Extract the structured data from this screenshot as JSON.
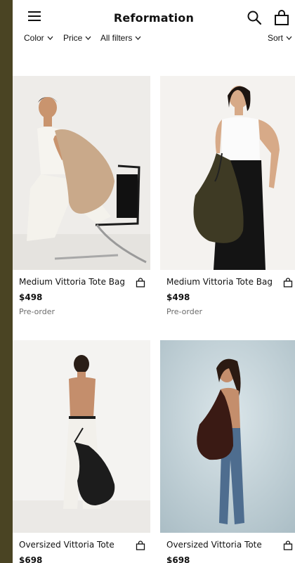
{
  "header": {
    "brand": "Reformation",
    "menu_icon": "hamburger-menu-icon",
    "search_icon": "search-icon",
    "cart_icon": "shopping-bag-icon"
  },
  "filters": {
    "color": "Color",
    "price": "Price",
    "all": "All filters",
    "sort": "Sort"
  },
  "products": [
    {
      "name": "Medium Vittoria Tote Bag",
      "price": "$498",
      "status": "Pre-order"
    },
    {
      "name": "Medium Vittoria Tote Bag",
      "price": "$498",
      "status": "Pre-order"
    },
    {
      "name": "Oversized Vittoria Tote",
      "price": "$698",
      "status": ""
    },
    {
      "name": "Oversized Vittoria Tote",
      "price": "$698",
      "status": ""
    }
  ],
  "colors": {
    "outer_background": "#4a4423",
    "bag_tan": "#c9a98a",
    "bag_olive": "#3e3a24",
    "bag_black": "#1c1c1c",
    "bag_brown": "#3a1a14"
  }
}
